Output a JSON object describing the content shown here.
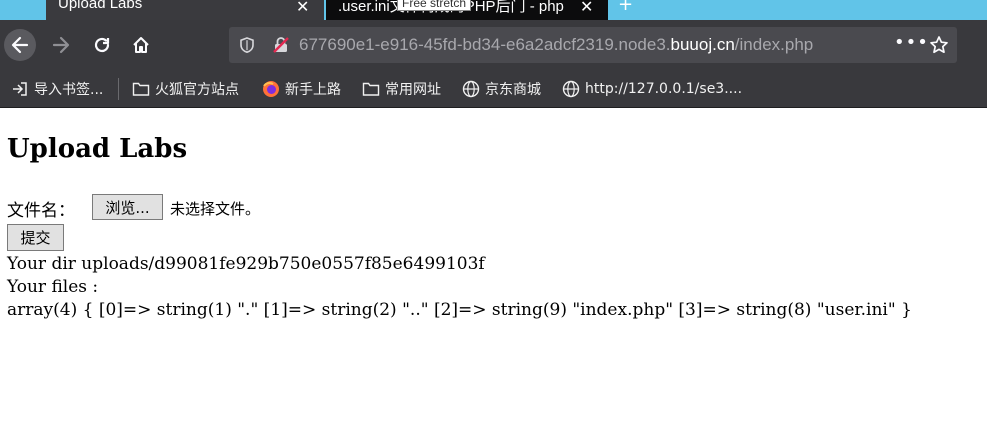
{
  "tabs": [
    {
      "title": "Upload Labs",
      "active": true
    },
    {
      "title": ".user.ini文件构成的PHP后门 - php"
    }
  ],
  "tooltip": {
    "text": "Free stretch"
  },
  "address_bar": {
    "url_prefix": "677690e1-e916-45fd-bd34-e6a2adcf2319.node3.",
    "url_domain": "buuoj.cn",
    "url_suffix": "/index.php"
  },
  "bookmarks": [
    {
      "label": "导入书签...",
      "icon": "import-icon"
    },
    {
      "label": "火狐官方站点",
      "icon": "folder-icon"
    },
    {
      "label": "新手上路",
      "icon": "firefox-icon"
    },
    {
      "label": "常用网址",
      "icon": "folder-icon"
    },
    {
      "label": "京东商城",
      "icon": "globe-icon"
    },
    {
      "label": "http://127.0.0.1/se3....",
      "icon": "globe-icon"
    }
  ],
  "page": {
    "heading": "Upload Labs",
    "file_label": "文件名：",
    "browse_button": "浏览...",
    "no_file_text": "未选择文件。",
    "submit_button": "提交",
    "dir_line": "Your dir uploads/d99081fe929b750e0557f85e6499103f",
    "files_label": "Your files :",
    "files_dump": "array(4) { [0]=> string(1) \".\" [1]=> string(2) \"..\" [2]=> string(9) \"index.php\" [3]=> string(8) \"user.ini\" }"
  },
  "colors": {
    "tab_strip": "#61c4e8",
    "toolbar": "#39393d",
    "urlbar": "#4a4a4f"
  }
}
